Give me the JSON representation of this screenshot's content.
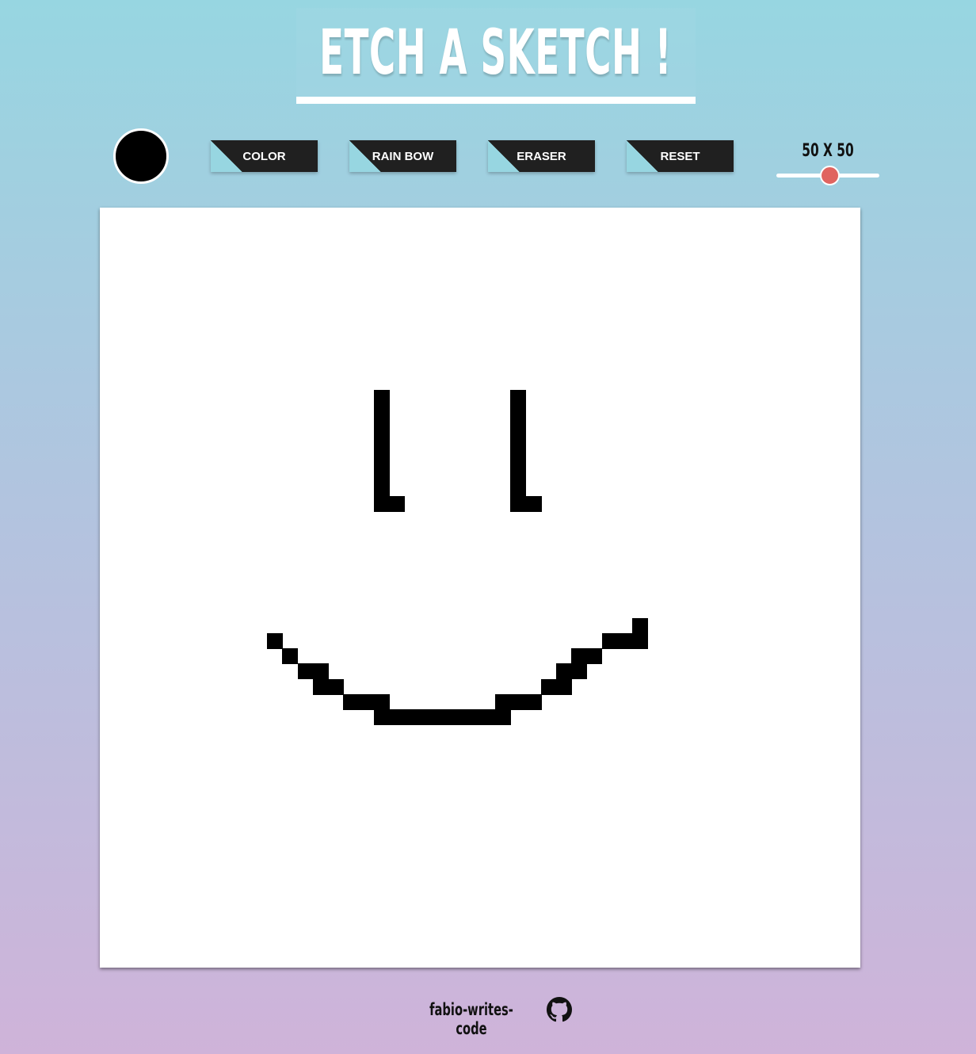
{
  "header": {
    "title": "ETCH A SKETCH !"
  },
  "toolbar": {
    "current_color": "#000000",
    "buttons": [
      {
        "label": "COLOR"
      },
      {
        "label": "RAIN BOW"
      },
      {
        "label": "ERASER"
      },
      {
        "label": "RESET"
      }
    ],
    "grid_size_label": "50 X 50",
    "grid_size_value": 50
  },
  "canvas": {
    "grid_size": 50,
    "filled_cells": [
      [
        18,
        12
      ],
      [
        18,
        13
      ],
      [
        18,
        14
      ],
      [
        18,
        15
      ],
      [
        18,
        16
      ],
      [
        18,
        17
      ],
      [
        18,
        18
      ],
      [
        18,
        19
      ],
      [
        19,
        19
      ],
      [
        27,
        12
      ],
      [
        27,
        13
      ],
      [
        27,
        14
      ],
      [
        27,
        15
      ],
      [
        27,
        16
      ],
      [
        27,
        17
      ],
      [
        27,
        18
      ],
      [
        27,
        19
      ],
      [
        28,
        19
      ],
      [
        11,
        28
      ],
      [
        12,
        29
      ],
      [
        13,
        30
      ],
      [
        14,
        30
      ],
      [
        14,
        31
      ],
      [
        15,
        31
      ],
      [
        16,
        32
      ],
      [
        17,
        32
      ],
      [
        18,
        32
      ],
      [
        18,
        33
      ],
      [
        19,
        33
      ],
      [
        20,
        33
      ],
      [
        21,
        33
      ],
      [
        22,
        33
      ],
      [
        23,
        33
      ],
      [
        24,
        33
      ],
      [
        25,
        33
      ],
      [
        26,
        33
      ],
      [
        26,
        32
      ],
      [
        27,
        32
      ],
      [
        28,
        32
      ],
      [
        29,
        31
      ],
      [
        30,
        31
      ],
      [
        30,
        30
      ],
      [
        31,
        30
      ],
      [
        31,
        29
      ],
      [
        32,
        29
      ],
      [
        33,
        28
      ],
      [
        34,
        28
      ],
      [
        35,
        28
      ],
      [
        35,
        27
      ]
    ]
  },
  "footer": {
    "author": "fabio-writes-code"
  },
  "colors": {
    "accent": "#97d6e1",
    "button_bg": "#202020",
    "slider_thumb": "#e06460"
  }
}
